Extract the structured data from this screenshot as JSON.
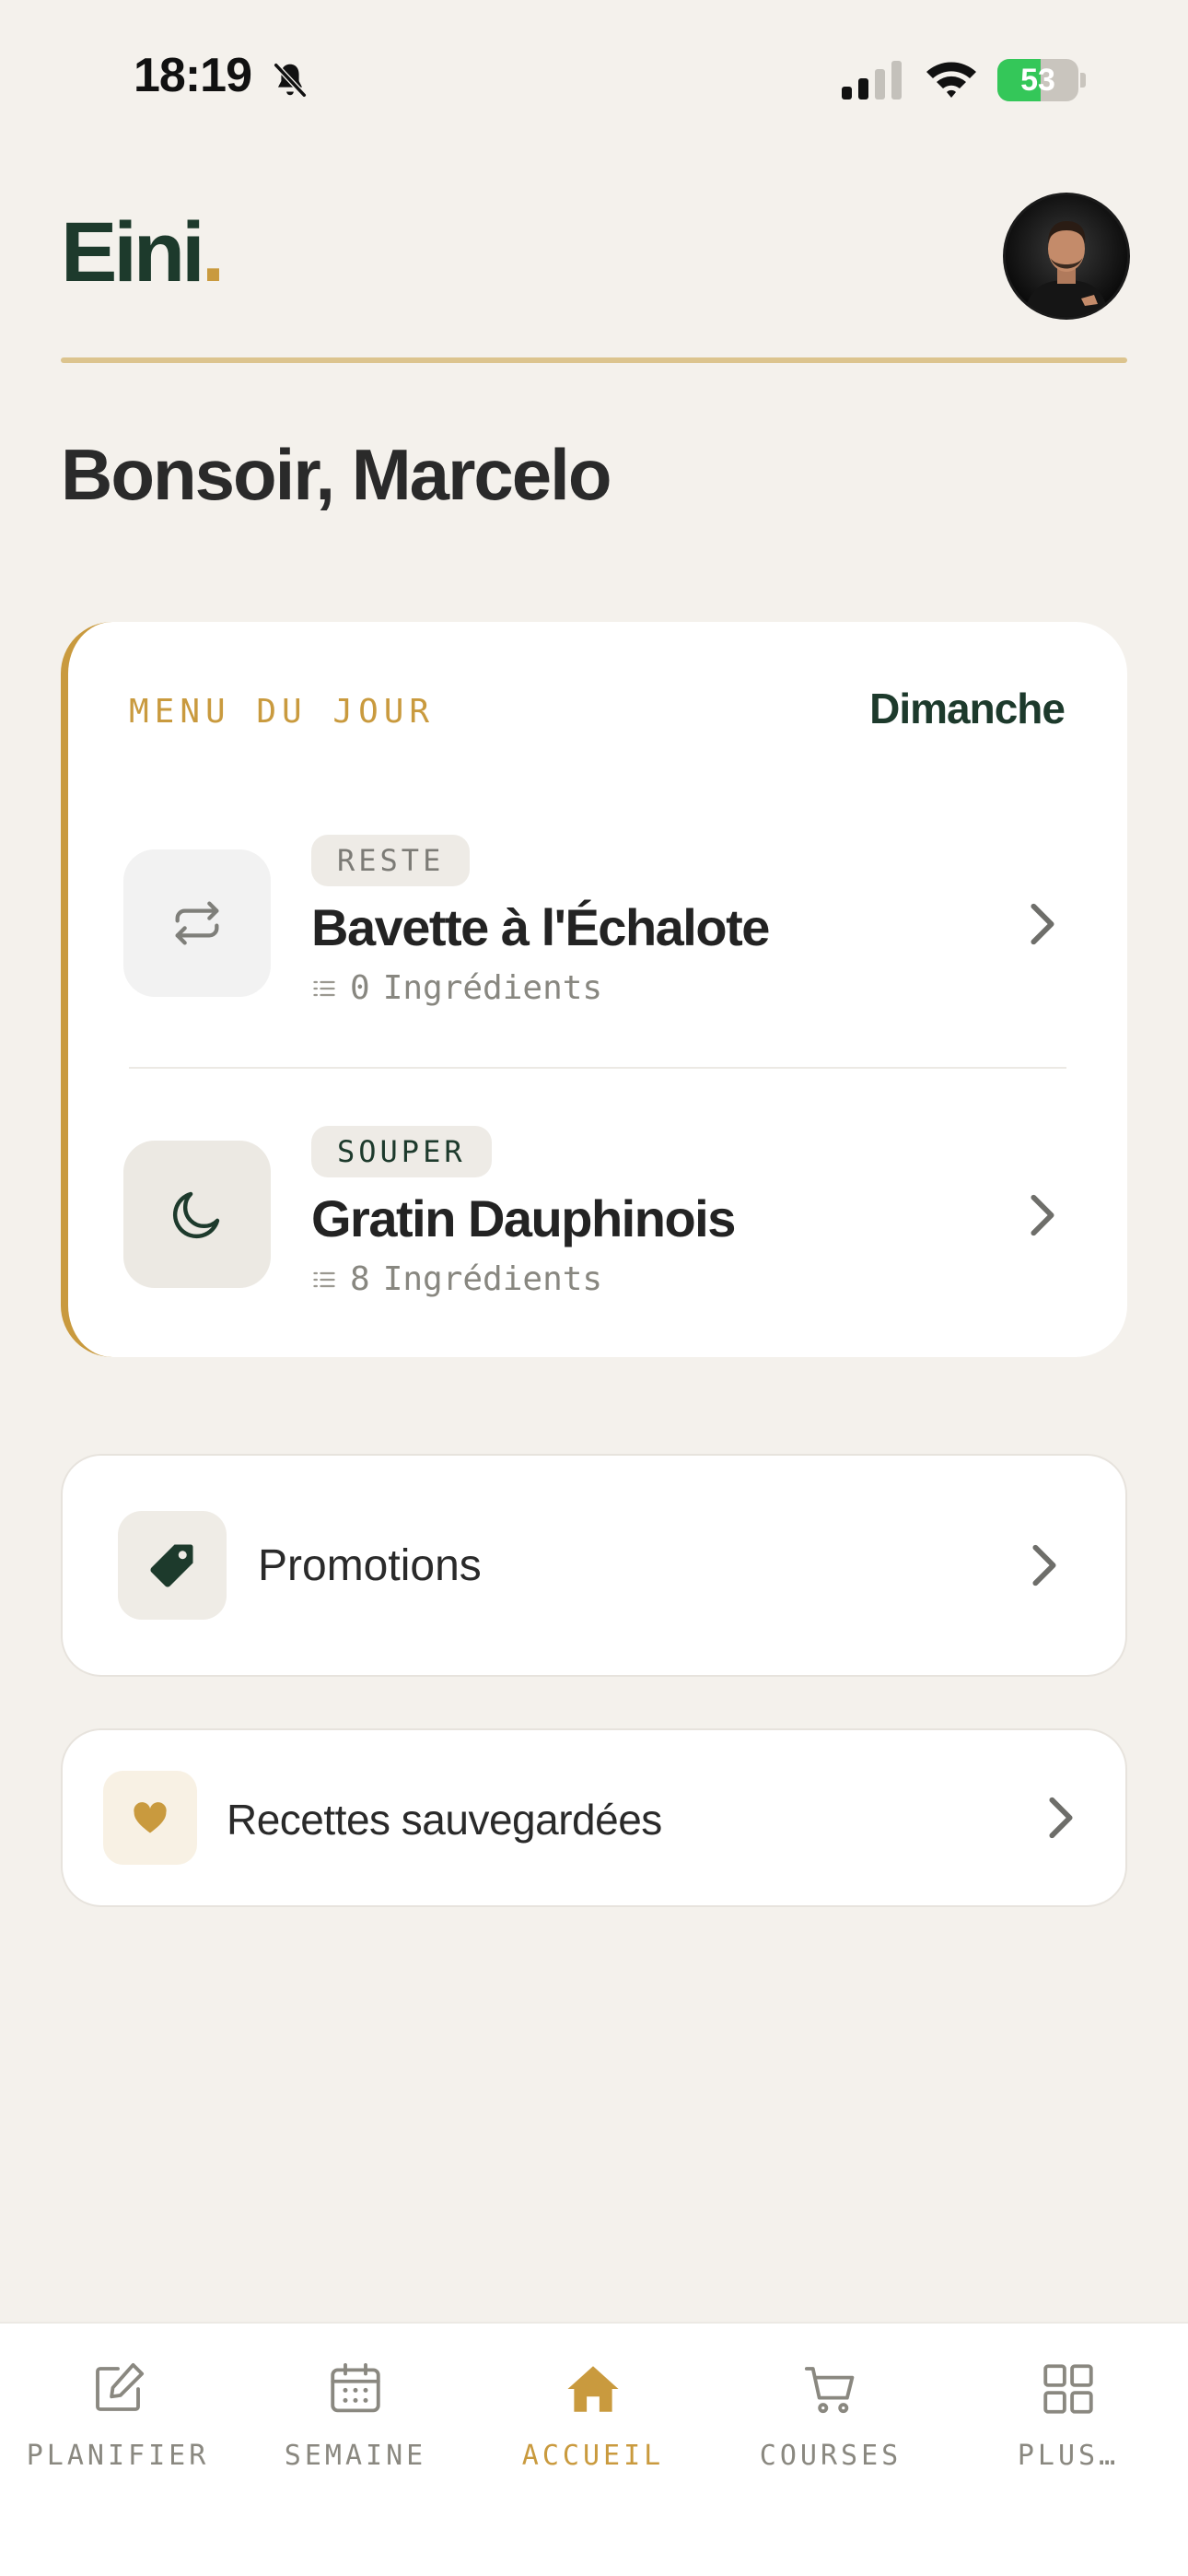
{
  "status_bar": {
    "time": "18:19",
    "battery_percent": "53",
    "battery_level": 0.53
  },
  "header": {
    "logo_text": "Eini",
    "logo_dot": ".",
    "avatar_icon": "profile-photo"
  },
  "greeting": "Bonsoir, Marcelo",
  "menu": {
    "kicker": "MENU DU JOUR",
    "day": "Dimanche",
    "meals": [
      {
        "badge": "RESTE",
        "title": "Bavette à l'Échalote",
        "count": "0",
        "count_label": "Ingrédients",
        "icon": "repeat-icon"
      },
      {
        "badge": "SOUPER",
        "title": "Gratin Dauphinois",
        "count": "8",
        "count_label": "Ingrédients",
        "icon": "moon-icon"
      }
    ]
  },
  "promotions": {
    "label": "Promotions",
    "icon": "tag-icon"
  },
  "saved": {
    "label": "Recettes sauvegardées",
    "icon": "heart-icon"
  },
  "tabs": [
    {
      "label": "PLANIFIER",
      "icon": "edit-icon"
    },
    {
      "label": "SEMAINE",
      "icon": "calendar-icon"
    },
    {
      "label": "ACCUEIL",
      "icon": "home-icon",
      "active": true
    },
    {
      "label": "COURSES",
      "icon": "cart-icon"
    },
    {
      "label": "PLUS…",
      "icon": "grid-icon"
    }
  ],
  "colors": {
    "background": "#F4F1EC",
    "brand_green": "#1D3A2C",
    "accent_gold": "#C99A3E",
    "battery_green": "#34C759"
  }
}
